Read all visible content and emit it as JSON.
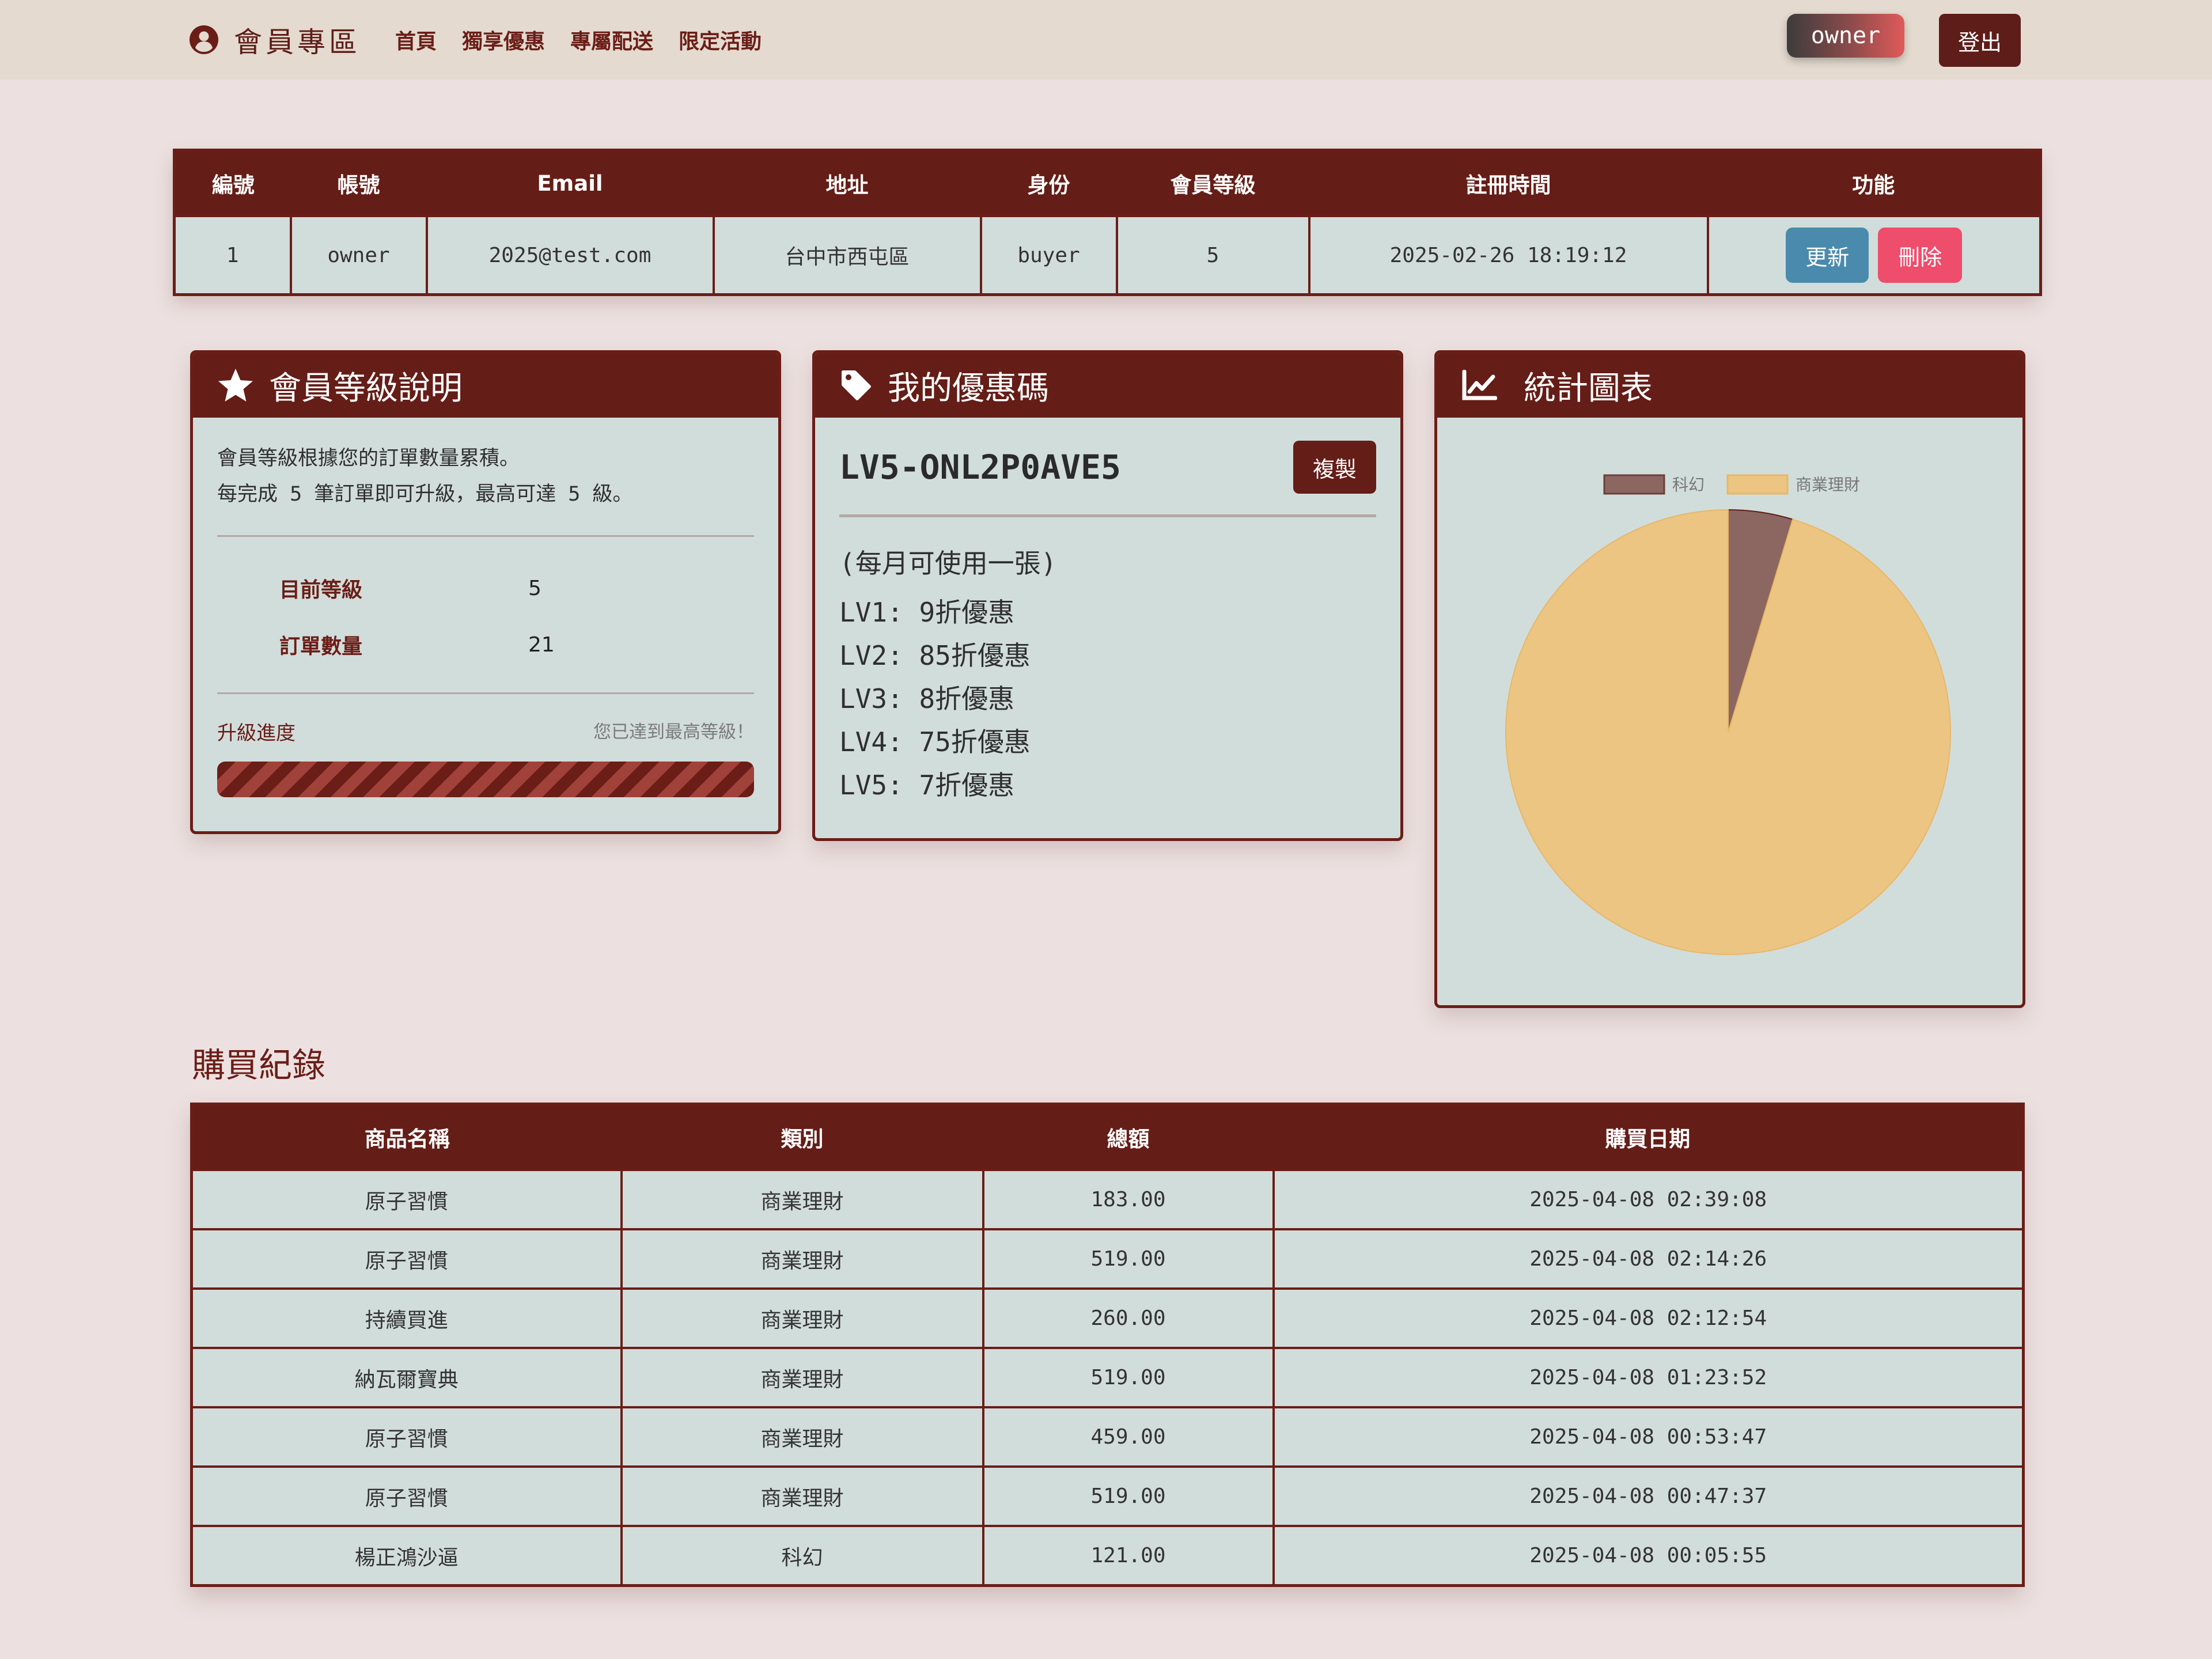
{
  "navbar": {
    "brand": "會員專區",
    "links": [
      "首頁",
      "獨享優惠",
      "專屬配送",
      "限定活動"
    ],
    "user": "owner",
    "logout": "登出"
  },
  "user_table": {
    "headers": [
      "編號",
      "帳號",
      "Email",
      "地址",
      "身份",
      "會員等級",
      "註冊時間",
      "功能"
    ],
    "row": {
      "id": "1",
      "account": "owner",
      "email": "2025@test.com",
      "address": "台中市西屯區",
      "role": "buyer",
      "level": "5",
      "registered": "2025-02-26 18:19:12"
    },
    "update_label": "更新",
    "delete_label": "刪除"
  },
  "level_card": {
    "title": "會員等級說明",
    "desc_line1": "會員等級根據您的訂單數量累積。",
    "desc_line2": "每完成 5 筆訂單即可升級，最高可達 5 級。",
    "current_level_label": "目前等級",
    "current_level": "5",
    "order_count_label": "訂單數量",
    "order_count": "21",
    "progress_label": "升級進度",
    "progress_note": "您已達到最高等級！",
    "progress": 1.0
  },
  "coupon_card": {
    "title": "我的優惠碼",
    "code": "LV5-ONL2P0AVE5",
    "copy_label": "複製",
    "note": "(每月可使用一張)",
    "levels": [
      "LV1: 9折優惠",
      "LV2: 85折優惠",
      "LV3: 8折優惠",
      "LV4: 75折優惠",
      "LV5: 7折優惠"
    ]
  },
  "chart_card": {
    "title": "統計圖表"
  },
  "chart_data": {
    "type": "pie",
    "categories": [
      "科幻",
      "商業理財"
    ],
    "values": [
      121.0,
      2460.0
    ],
    "colors": [
      "#8c6762",
      "#ecc583"
    ],
    "legend": "top"
  },
  "purchases": {
    "title": "購買紀錄",
    "headers": [
      "商品名稱",
      "類別",
      "總額",
      "購買日期"
    ],
    "rows": [
      [
        "原子習慣",
        "商業理財",
        "183.00",
        "2025-04-08 02:39:08"
      ],
      [
        "原子習慣",
        "商業理財",
        "519.00",
        "2025-04-08 02:14:26"
      ],
      [
        "持續買進",
        "商業理財",
        "260.00",
        "2025-04-08 02:12:54"
      ],
      [
        "納瓦爾寶典",
        "商業理財",
        "519.00",
        "2025-04-08 01:23:52"
      ],
      [
        "原子習慣",
        "商業理財",
        "459.00",
        "2025-04-08 00:53:47"
      ],
      [
        "原子習慣",
        "商業理財",
        "519.00",
        "2025-04-08 00:47:37"
      ],
      [
        "楊正鴻沙逼",
        "科幻",
        "121.00",
        "2025-04-08 00:05:55"
      ]
    ]
  }
}
